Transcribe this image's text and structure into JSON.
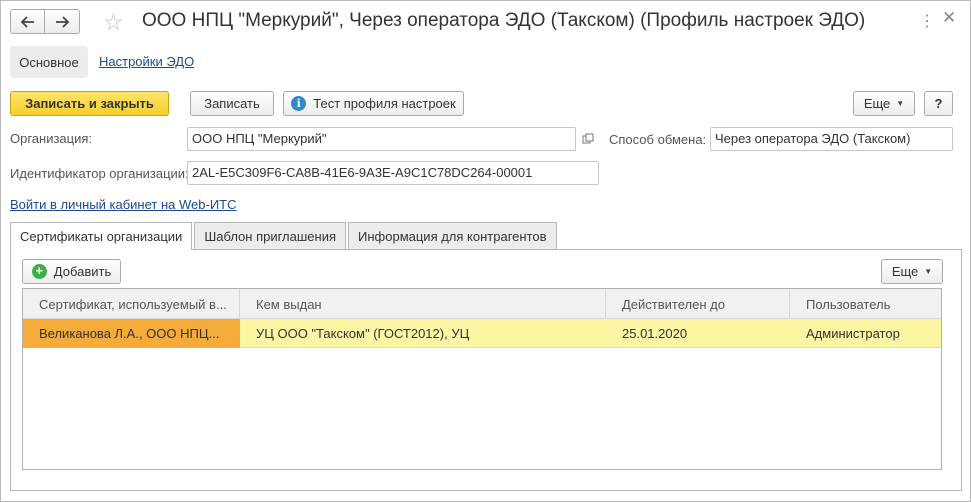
{
  "header": {
    "title": "ООО НПЦ \"Меркурий\", Через оператора ЭДО (Такском) (Профиль настроек ЭДО)",
    "back_icon": "arrow-left-icon",
    "forward_icon": "arrow-right-icon",
    "favorite_icon": "star-icon",
    "more_icon": "more-dots-icon",
    "close_icon": "close-icon"
  },
  "sections": {
    "main": "Основное",
    "edo_settings": "Настройки ЭДО"
  },
  "toolbar": {
    "save_close": "Записать и закрыть",
    "save": "Записать",
    "test_profile": "Тест профиля настроек",
    "more": "Еще",
    "help": "?"
  },
  "form": {
    "organization_label": "Организация:",
    "organization_value": "ООО НПЦ \"Меркурий\"",
    "exchange_method_label": "Способ обмена:",
    "exchange_method_value": "Через оператора ЭДО (Такском)",
    "org_id_label": "Идентификатор организации:",
    "org_id_value": "2AL-E5C309F6-CA8B-41E6-9A3E-A9C1C78DC264-00001",
    "web_its_link": "Войти в личный кабинет на Web-ИТС"
  },
  "tabs": [
    {
      "label": "Сертификаты организации",
      "active": true
    },
    {
      "label": "Шаблон приглашения",
      "active": false
    },
    {
      "label": "Информация для контрагентов",
      "active": false
    }
  ],
  "certificates": {
    "add_button": "Добавить",
    "more_button": "Еще",
    "columns": [
      "Сертификат, используемый в...",
      "Кем выдан",
      "Действителен до",
      "Пользователь"
    ],
    "rows": [
      [
        "Великанова Л.А., ООО НПЦ...",
        "УЦ ООО \"Такском\" (ГОСТ2012), УЦ",
        "25.01.2020",
        "Администратор"
      ]
    ]
  },
  "colors": {
    "primary_button": "#f5cf2a",
    "link": "#1a4a8f",
    "selected_row": "#fbf6a4",
    "selected_cell": "#f4ab3a"
  }
}
